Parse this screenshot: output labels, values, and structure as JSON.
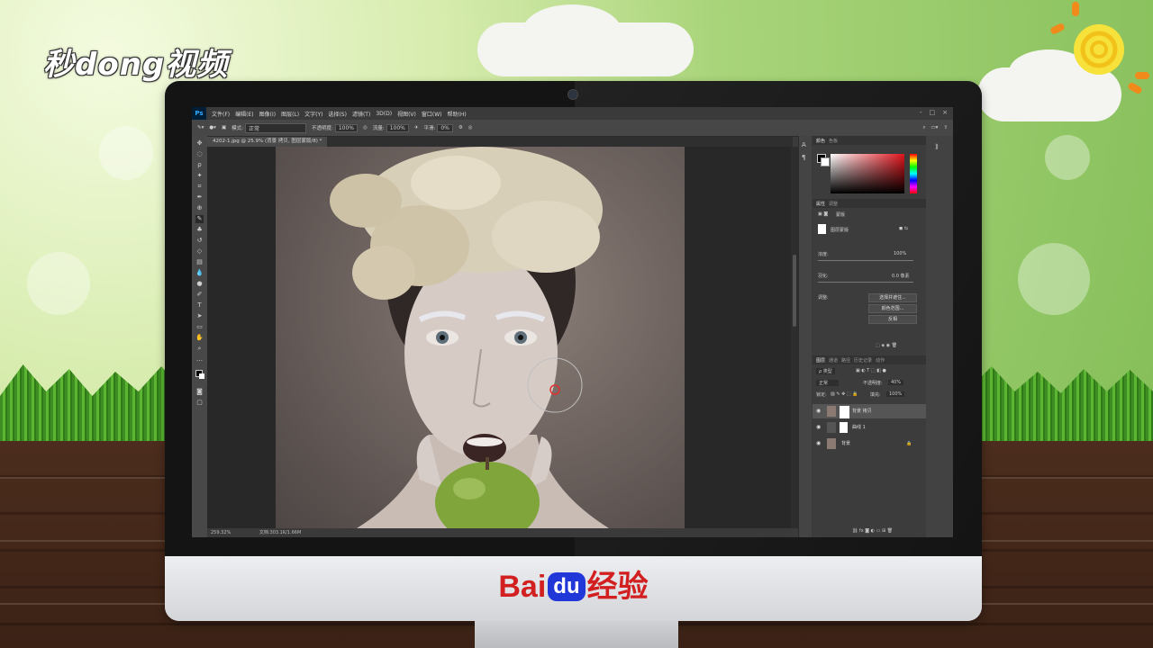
{
  "branding": {
    "watermark_logo": "秒dong视频",
    "baidu_left": "Bai",
    "baidu_du": "du",
    "baidu_right": "经验"
  },
  "photoshop": {
    "app_icon": "Ps",
    "menu": [
      "文件(F)",
      "编辑(E)",
      "图像(I)",
      "图层(L)",
      "文字(Y)",
      "选择(S)",
      "滤镜(T)",
      "3D(D)",
      "视图(V)",
      "窗口(W)",
      "帮助(H)"
    ],
    "window_controls": [
      "-",
      "□",
      "×"
    ],
    "options": {
      "mode_label": "模式:",
      "mode_value": "正常",
      "opacity_label": "不透明度:",
      "opacity_value": "100%",
      "flow_label": "流量:",
      "flow_value": "100%",
      "smooth_label": "平滑:",
      "smooth_value": "0%"
    },
    "document_tab": "4202-1.jpg @ 25.9% (背景 拷贝, 图层蒙版/8) *",
    "status": {
      "zoom": "259.32%",
      "doc": "文档:303.1K/1.66M"
    },
    "panels": {
      "color_tabs": [
        "颜色",
        "色板"
      ],
      "properties_tabs": [
        "属性",
        "调整"
      ],
      "properties_title": "蒙版",
      "mask_label": "图层蒙版",
      "density_label": "浓度:",
      "density_value": "100%",
      "feather_label": "羽化:",
      "feather_value": "0.0 像素",
      "adjust_label": "调整:",
      "btn_select_mask": "选择并遮住...",
      "btn_color_range": "颜色范围...",
      "btn_invert": "反相",
      "layers_tabs": [
        "图层",
        "通道",
        "路径",
        "历史记录",
        "动作"
      ],
      "layer_kind": "ρ 类型",
      "blend_mode": "正常",
      "layer_opacity_label": "不透明度:",
      "layer_opacity_value": "40%",
      "lock_label": "锁定:",
      "fill_label": "填充:",
      "fill_value": "100%",
      "layers": [
        {
          "name": "背景 拷贝"
        },
        {
          "name": "曲线 1"
        },
        {
          "name": "背景"
        }
      ]
    }
  }
}
